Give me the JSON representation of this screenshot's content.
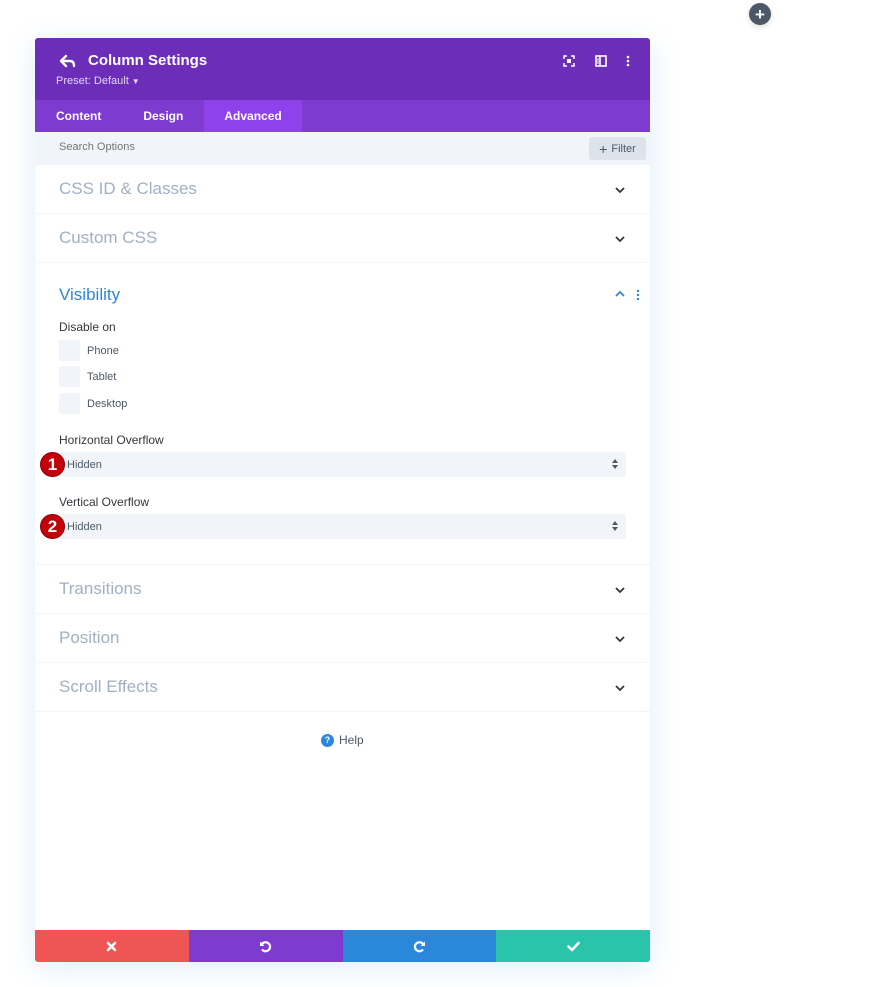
{
  "page": {
    "add_button_icon": "plus-icon"
  },
  "header": {
    "title": "Column Settings",
    "preset_label": "Preset: Default",
    "icons": [
      "back-icon",
      "fullscreen-icon",
      "split-view-icon",
      "more-vertical-icon"
    ],
    "colors": {
      "header_bg": "#6c2eb9",
      "tabs_bg": "#7e3bd0",
      "active_tab_bg": "#8f42ec"
    }
  },
  "tabs": [
    {
      "label": "Content",
      "active": false
    },
    {
      "label": "Design",
      "active": false
    },
    {
      "label": "Advanced",
      "active": true
    }
  ],
  "search": {
    "placeholder": "Search Options",
    "filter_label": "Filter"
  },
  "sections": {
    "css_id": {
      "title": "CSS ID & Classes",
      "expanded": false
    },
    "custom_css": {
      "title": "Custom CSS",
      "expanded": false
    },
    "visibility": {
      "title": "Visibility",
      "expanded": true,
      "disable_on_label": "Disable on",
      "options": [
        {
          "label": "Phone",
          "checked": false
        },
        {
          "label": "Tablet",
          "checked": false
        },
        {
          "label": "Desktop",
          "checked": false
        }
      ],
      "horizontal_overflow": {
        "label": "Horizontal Overflow",
        "value": "Hidden",
        "marker": "1"
      },
      "vertical_overflow": {
        "label": "Vertical Overflow",
        "value": "Hidden",
        "marker": "2"
      }
    },
    "transitions": {
      "title": "Transitions",
      "expanded": false
    },
    "position": {
      "title": "Position",
      "expanded": false
    },
    "scroll_effects": {
      "title": "Scroll Effects",
      "expanded": false
    }
  },
  "help": {
    "label": "Help",
    "icon": "question-icon"
  },
  "footer": {
    "buttons": [
      {
        "action": "cancel",
        "icon": "close-icon",
        "color": "#ef5555"
      },
      {
        "action": "undo",
        "icon": "undo-icon",
        "color": "#7e3bd0"
      },
      {
        "action": "redo",
        "icon": "redo-icon",
        "color": "#2b87da"
      },
      {
        "action": "save",
        "icon": "check-icon",
        "color": "#29c4a9"
      }
    ]
  }
}
